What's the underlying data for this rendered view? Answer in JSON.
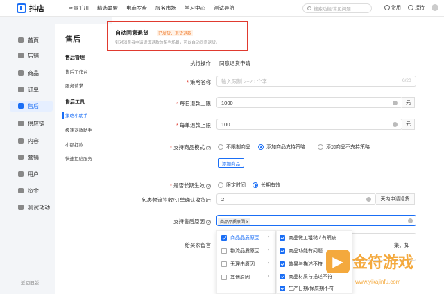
{
  "app": {
    "name": "抖店",
    "nav": [
      "巨量千川",
      "精选联盟",
      "电商罗盘",
      "服务市场",
      "学习中心",
      "测试导航"
    ],
    "search_placeholder": "搜索功能/常见问题",
    "right": [
      "常用",
      "接待"
    ]
  },
  "sidebar": {
    "items": [
      "首页",
      "店铺",
      "商品",
      "订单",
      "售后",
      "供应链",
      "内容",
      "营销",
      "用户",
      "资金",
      "测试动动"
    ],
    "active": "售后",
    "footer": "返回旧版"
  },
  "sub": {
    "title": "售后",
    "groups": [
      {
        "title": "售后管理",
        "items": [
          "售后工作台",
          "服务请求"
        ]
      },
      {
        "title": "售后工具",
        "items": [
          "策略小助手",
          "极速退款助手",
          "小额打款",
          "快速拒赔服务"
        ]
      }
    ],
    "active": "策略小助手"
  },
  "card": {
    "title": "自动同意退货",
    "tag": "已发货、退货退款",
    "desc": "针对消费者申请退货退款的某些场景，可以自动同意退货。"
  },
  "form": {
    "exec_label": "执行操作",
    "exec_value": "同意退货申请",
    "name_label": "策略名称",
    "name_placeholder": "输入限制 2~20 个字",
    "name_count": "0/20",
    "daily_label": "每日退款上限",
    "daily_value": "1000",
    "daily_unit": "元",
    "single_label": "每单退款上限",
    "single_value": "100",
    "single_unit": "元",
    "mode_label": "支持商品模式",
    "mode_opts": [
      "不限制商品",
      "添加商品支持策略",
      "添加商品不支持策略"
    ],
    "mode_selected": "添加商品支持策略",
    "add_goods": "添加商品",
    "long_label": "是否长期生效",
    "long_opts": [
      "限定时间",
      "长期有效"
    ],
    "long_selected": "长期有效",
    "pkg_label": "包裹物流签收/订单确认收货后",
    "pkg_value": "2",
    "pkg_unit": "天内申请退货",
    "reason_label": "支持售后原因",
    "reason_chip": "商品品质原因 ×",
    "msg_label": "给买家留言",
    "msg_partial": "集、如",
    "dd_left": [
      "商品品质原因",
      "物流品质原因",
      "无理由原因",
      "其他原因"
    ],
    "dd_right": [
      "商品做工粗糙 / 有瑕疵",
      "商品功能有问题",
      "效果与描述不符",
      "商品材质与描述不符",
      "生产日期/保质期不符"
    ]
  },
  "watermark": {
    "text": "金符游戏",
    "url": "www.yikajinfu.com"
  }
}
